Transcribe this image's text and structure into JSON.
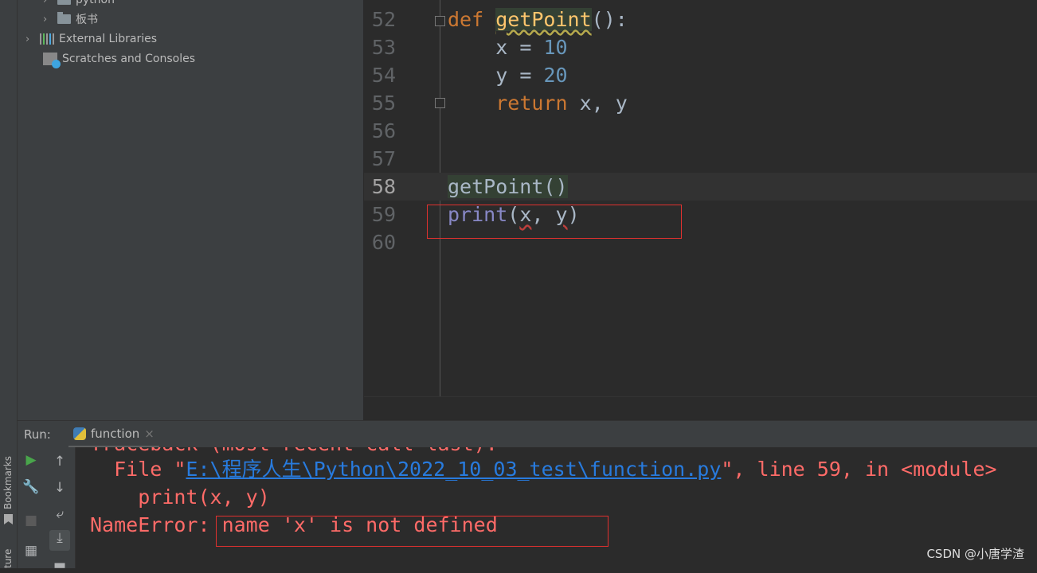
{
  "project_tree": {
    "items": [
      {
        "label": "python",
        "icon": "folder-icon"
      },
      {
        "label": "板书",
        "icon": "folder-icon"
      },
      {
        "label": "External Libraries",
        "icon": "libraries-icon"
      },
      {
        "label": "Scratches and Consoles",
        "icon": "scratches-icon"
      }
    ]
  },
  "editor": {
    "line_numbers": [
      "52",
      "53",
      "54",
      "55",
      "56",
      "57",
      "58",
      "59",
      "60"
    ],
    "current_line": "58",
    "code": {
      "def": "def",
      "fn_name": "getPoint",
      "def_tail": "():",
      "x": "x = ",
      "x_val": "10",
      "y": "y = ",
      "y_val": "20",
      "ret": "return",
      "ret_tail": " x, y",
      "call": "getPoint()",
      "print": "print",
      "p_open": "(",
      "p_x": "x",
      "p_comma": ", ",
      "p_y": "y",
      "p_close": ")"
    }
  },
  "run": {
    "label": "Run:",
    "tab": "function"
  },
  "console": {
    "line0": "Traceback (most recent call last):",
    "file_prefix": "File \"",
    "file_path": "E:\\程序人生\\Python\\2022_10_03_test\\function.py",
    "file_suffix": "\", line 59, in <module>",
    "line2": "print(x, y)",
    "err_type": "NameError:",
    "err_msg": " name 'x' is not defined"
  },
  "side": {
    "bookmarks": "Bookmarks",
    "structure": "ture"
  },
  "watermark": "CSDN @小唐学渣",
  "colors": {
    "error": "#ff6b68",
    "link": "#287bde",
    "highlight_box": "#e0312f"
  }
}
